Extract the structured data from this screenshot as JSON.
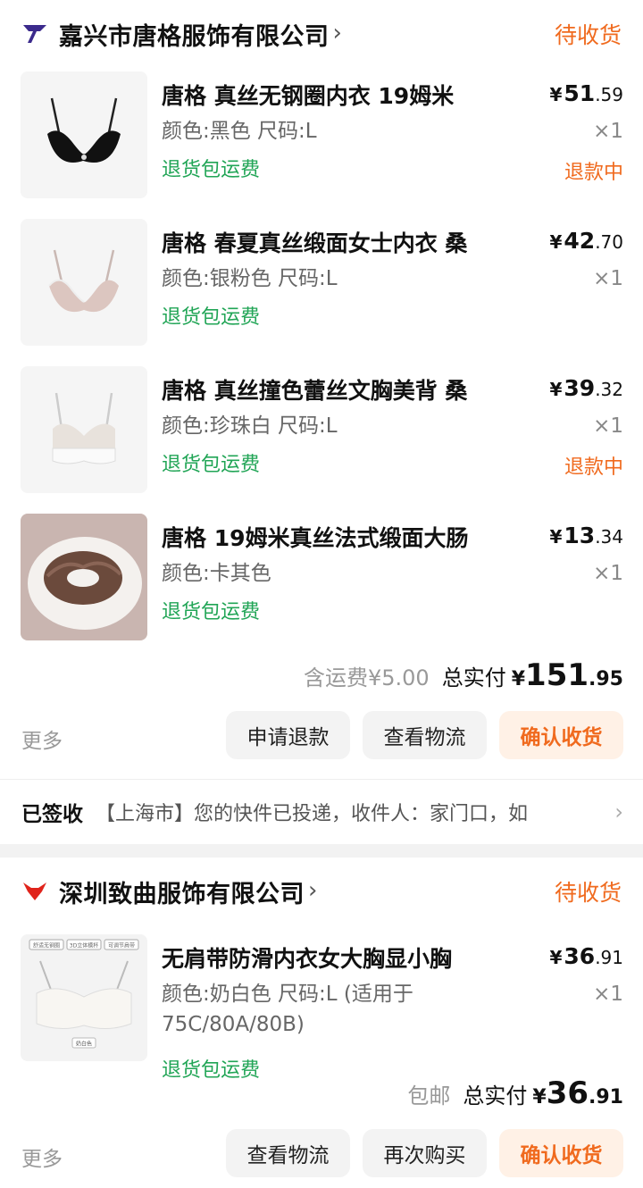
{
  "orders": [
    {
      "shop_name": "嘉兴市唐格服饰有限公司",
      "shop_chevron": "›",
      "status": "待收货",
      "items": [
        {
          "title": "唐格 真丝无钢圈内衣 19姆米",
          "spec": "颜色:黑色 尺码:L",
          "tag": "退货包运费",
          "currency": "¥",
          "price_int": "51",
          "price_dec": ".59",
          "qty": "×1",
          "refund": "退款中"
        },
        {
          "title": "唐格 春夏真丝缎面女士内衣 桑",
          "spec": "颜色:银粉色 尺码:L",
          "tag": "退货包运费",
          "currency": "¥",
          "price_int": "42",
          "price_dec": ".70",
          "qty": "×1",
          "refund": ""
        },
        {
          "title": "唐格 真丝撞色蕾丝文胸美背 桑",
          "spec": "颜色:珍珠白 尺码:L",
          "tag": "退货包运费",
          "currency": "¥",
          "price_int": "39",
          "price_dec": ".32",
          "qty": "×1",
          "refund": "退款中"
        },
        {
          "title": "唐格 19姆米真丝法式缎面大肠",
          "spec": "颜色:卡其色",
          "tag": "退货包运费",
          "currency": "¥",
          "price_int": "13",
          "price_dec": ".34",
          "qty": "×1",
          "refund": ""
        }
      ],
      "shipping": "含运费¥5.00",
      "total_label": "总实付",
      "total_currency": "¥",
      "total_int": "151",
      "total_dec": ".95",
      "more": "更多",
      "buttons": [
        "申请退款",
        "查看物流",
        "确认收货"
      ],
      "logistics_status": "已签收",
      "logistics_text": "【上海市】您的快件已投递，收件人：家门口，如",
      "logistics_chevron": "›"
    },
    {
      "shop_name": "深圳致曲服饰有限公司",
      "shop_chevron": "›",
      "status": "待收货",
      "items": [
        {
          "title": "无肩带防滑内衣女大胸显小胸",
          "spec": "颜色:奶白色 尺码:L (适用于75C/80A/80B)",
          "tag": "退货包运费",
          "currency": "¥",
          "price_int": "36",
          "price_dec": ".91",
          "qty": "×1",
          "refund": ""
        }
      ],
      "shipping": "包邮",
      "total_label": "总实付",
      "total_currency": "¥",
      "total_int": "36",
      "total_dec": ".91",
      "more": "更多",
      "buttons": [
        "查看物流",
        "再次购买",
        "确认收货"
      ]
    }
  ],
  "thumb_labels": {
    "tag1": "舒适无钢圈",
    "tag2": "3D立体模杯",
    "tag3": "可调节肩带",
    "color": "奶白色"
  },
  "colors": {
    "accent": "#f06a1e",
    "green": "#21a556",
    "shop1_logo": "#3b2a8c",
    "shop2_logo": "#e0231b"
  }
}
